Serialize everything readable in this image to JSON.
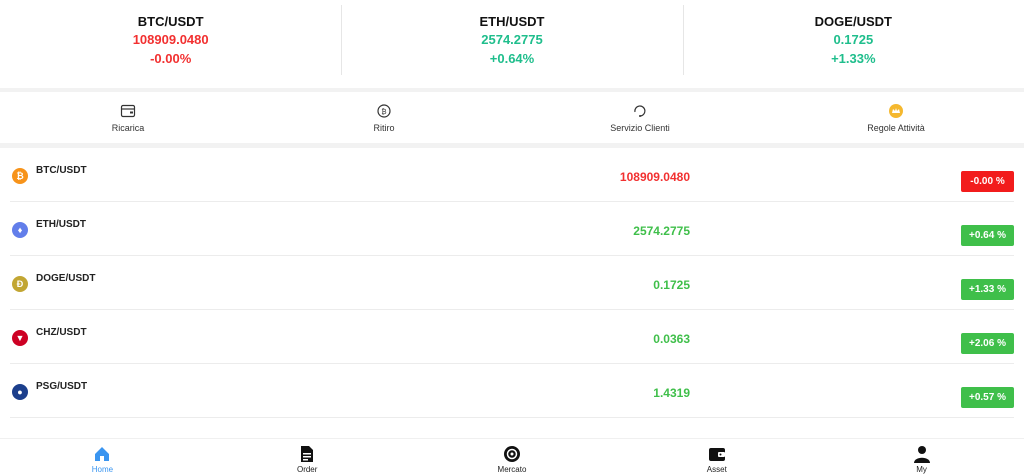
{
  "tickers": [
    {
      "pair": "BTC/USDT",
      "price": "108909.0480",
      "change": "-0.00%"
    },
    {
      "pair": "ETH/USDT",
      "price": "2574.2775",
      "change": "+0.64%"
    },
    {
      "pair": "DOGE/USDT",
      "price": "0.1725",
      "change": "+1.33%"
    }
  ],
  "actions": [
    {
      "label": "Ricarica",
      "icon": "wallet-icon"
    },
    {
      "label": "Ritiro",
      "icon": "withdraw-icon"
    },
    {
      "label": "Servizio Clienti",
      "icon": "customer-service-icon"
    },
    {
      "label": "Regole Attività",
      "icon": "crown-icon"
    }
  ],
  "market": [
    {
      "pair": "BTC/USDT",
      "price": "108909.0480",
      "change": "-0.00 %",
      "icon": "btc-icon",
      "color": "#f7931a"
    },
    {
      "pair": "ETH/USDT",
      "price": "2574.2775",
      "change": "+0.64 %",
      "icon": "eth-icon",
      "color": "#627eea"
    },
    {
      "pair": "DOGE/USDT",
      "price": "0.1725",
      "change": "+1.33 %",
      "icon": "doge-icon",
      "color": "#c2a633"
    },
    {
      "pair": "CHZ/USDT",
      "price": "0.0363",
      "change": "+2.06 %",
      "icon": "chz-icon",
      "color": "#cd0124"
    },
    {
      "pair": "PSG/USDT",
      "price": "1.4319",
      "change": "+0.57 %",
      "icon": "psg-icon",
      "color": "#1c3f8c"
    }
  ],
  "nav": [
    {
      "label": "Home",
      "icon": "home-icon"
    },
    {
      "label": "Order",
      "icon": "order-icon"
    },
    {
      "label": "Mercato",
      "icon": "market-icon"
    },
    {
      "label": "Asset",
      "icon": "asset-icon"
    },
    {
      "label": "My",
      "icon": "user-icon"
    }
  ],
  "colors": {
    "down": "#f23030",
    "up_ticker": "#1fbe8c",
    "up": "#3fbf4a",
    "active": "#3a95f0"
  }
}
